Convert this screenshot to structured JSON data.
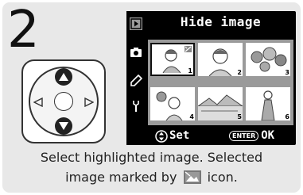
{
  "step": {
    "number": "2"
  },
  "dpad": {
    "up": "up-arrow-icon",
    "down": "down-arrow-icon",
    "left": "left-arrow-icon",
    "right": "right-arrow-icon"
  },
  "screen": {
    "title": "Hide image",
    "sidebar": [
      "playback-icon",
      "camera-icon",
      "pencil-icon",
      "wrench-icon"
    ],
    "thumbnails": [
      {
        "num": "1",
        "selected": true,
        "hidden": true
      },
      {
        "num": "2",
        "selected": false,
        "hidden": false
      },
      {
        "num": "3",
        "selected": false,
        "hidden": false
      },
      {
        "num": "4",
        "selected": false,
        "hidden": false
      },
      {
        "num": "5",
        "selected": false,
        "hidden": false
      },
      {
        "num": "6",
        "selected": false,
        "hidden": false
      }
    ],
    "footer": {
      "set_label": "Set",
      "enter_label": "ENTER",
      "ok_label": "OK"
    }
  },
  "caption": {
    "line1": "Select highlighted image.  Selected",
    "line2_before": "image marked by",
    "line2_after": "icon."
  },
  "colors": {
    "panel": "#e8e8e8",
    "screen": "#000000",
    "thumb_bg": "#9a9a9a"
  }
}
